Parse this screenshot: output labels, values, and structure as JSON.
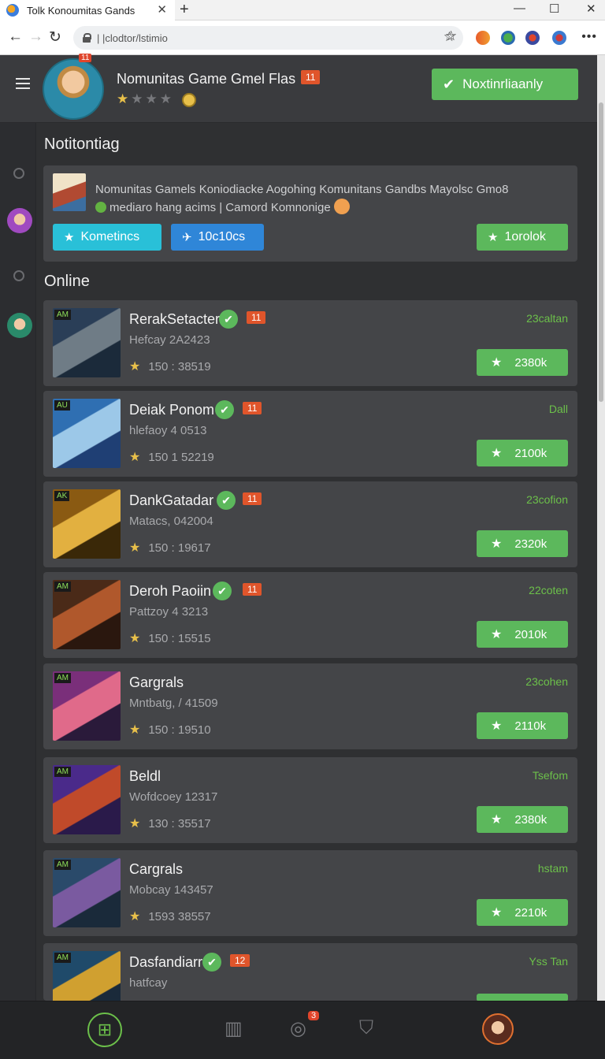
{
  "browser": {
    "tab_title": "Tolk Konoumitas Gands",
    "url": "| |clodtor/lstimio"
  },
  "header": {
    "avatar_badge": "11",
    "title": "Nomunitas Game Gmel Flas",
    "badge": "11",
    "rating_stars": 1,
    "rating_max": 4,
    "notify_label": "Noxtinrliaanly"
  },
  "sections": {
    "notifications": "Notitontiag",
    "online": "Online"
  },
  "notification": {
    "line1": "Nomunitas Gamels Koniodiacke Aogohing Komunitans Gandbs Mayolsc Gmo8",
    "line2": "mediaro hang acims | Camord Komnonige",
    "btn1": "Kometincs",
    "btn2": "10c10cs",
    "btn3": "1orolok"
  },
  "games": [
    {
      "name": "RerakSetacter",
      "badge": "11",
      "sub": "Hefcay 2A2423",
      "stat": "150 : 38519",
      "status": "23caltan",
      "btn": "2380k",
      "tag": "AM",
      "colors": [
        "#2a3e57",
        "#6f7c86",
        "#1b2a3a"
      ]
    },
    {
      "name": "Deiak Ponom",
      "badge": "11",
      "sub": "hlefaoy 4 0513",
      "stat": "150 1 52219",
      "status": "Dall",
      "btn": "2100k",
      "tag": "AU",
      "colors": [
        "#2f6fb2",
        "#9cc8e8",
        "#1f3f74"
      ]
    },
    {
      "name": "DankGatadar",
      "badge": "11",
      "sub": "Matacs, 042004",
      "stat": "150 : 19617",
      "status": "23cofion",
      "btn": "2320k",
      "tag": "AK",
      "colors": [
        "#8a5a12",
        "#e2b040",
        "#3a2808"
      ]
    },
    {
      "name": "Deroh Paoiin",
      "badge": "11",
      "sub": "Pattzoy 4 3213",
      "stat": "150 : 15515",
      "status": "22coten",
      "btn": "2010k",
      "tag": "AM",
      "colors": [
        "#4a2a18",
        "#b0582c",
        "#2a170e"
      ]
    },
    {
      "name": "Gargrals",
      "badge": "",
      "sub": "Mntbatg, / 41509",
      "stat": "150 : 19510",
      "status": "23cohen",
      "btn": "2110k",
      "tag": "AM",
      "colors": [
        "#7a2f7a",
        "#e06a8a",
        "#2a1a3a"
      ]
    },
    {
      "name": "Beldl",
      "badge": "",
      "sub": "Wofdcoey 12317",
      "stat": "130 : 35517",
      "status": "Tsefom",
      "btn": "2380k",
      "tag": "AM",
      "colors": [
        "#4a2a8a",
        "#c04a2a",
        "#2a1a4a"
      ]
    },
    {
      "name": "Cargrals",
      "badge": "",
      "sub": "Mobcay 143457",
      "stat": "1593 38557",
      "status": "hstam",
      "btn": "2210k",
      "tag": "AM",
      "colors": [
        "#2a4a6a",
        "#7a5aa0",
        "#1a2a3a"
      ]
    },
    {
      "name": "Dasfandiarr",
      "badge": "12",
      "sub": "hatfcay",
      "stat": "",
      "status": "Yss Tan",
      "btn": "",
      "tag": "AM",
      "colors": [
        "#1f4a6a",
        "#d0a030",
        "#1a2a3a"
      ]
    }
  ],
  "bottom_nav": {
    "notif_count": "3"
  }
}
